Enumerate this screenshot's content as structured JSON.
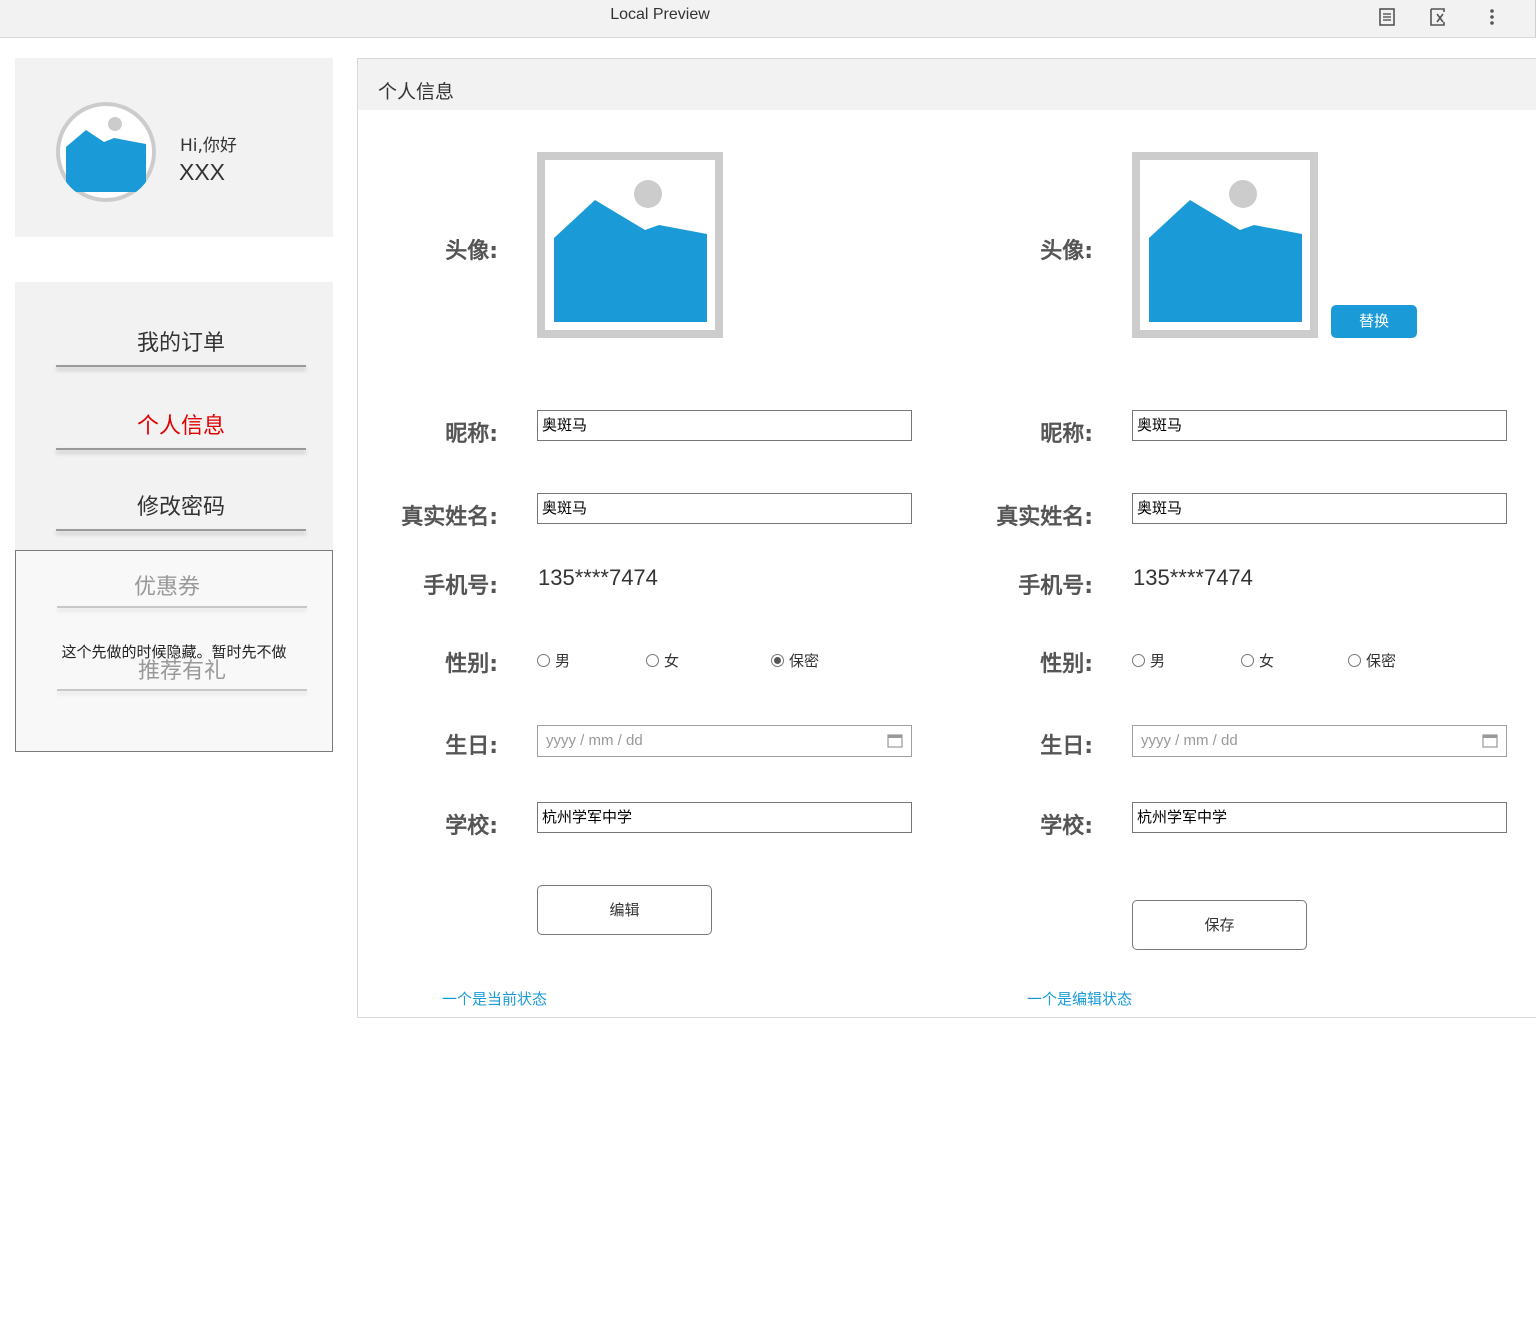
{
  "window": {
    "title": "Local Preview"
  },
  "toolbar": {
    "icons": [
      "document-icon",
      "variable-icon",
      "more-vert-icon"
    ]
  },
  "profile": {
    "greeting": "Hi,你好",
    "username": "XXX"
  },
  "nav": {
    "items": [
      {
        "label": "我的订单",
        "active": false
      },
      {
        "label": "个人信息",
        "active": true
      },
      {
        "label": "修改密码",
        "active": false
      }
    ],
    "hidden_items": [
      "优惠券",
      "推荐有礼"
    ],
    "hidden_note": "这个先做的时候隐藏。暂时先不做"
  },
  "main": {
    "title": "个人信息",
    "labels": {
      "avatar": "头像:",
      "nickname": "昵称:",
      "realname": "真实姓名:",
      "phone": "手机号:",
      "gender": "性别:",
      "birthday": "生日:",
      "school": "学校:"
    },
    "view": {
      "nickname": "奥斑马",
      "realname": "奥斑马",
      "phone": "135****7474",
      "gender_options": [
        "男",
        "女",
        "保密"
      ],
      "gender_selected": "保密",
      "birthday_placeholder": "yyyy / mm / dd",
      "school": "杭州学军中学",
      "action_label": "编辑",
      "state_note": "一个是当前状态"
    },
    "edit": {
      "replace_label": "替换",
      "nickname": "奥斑马",
      "realname": "奥斑马",
      "phone": "135****7474",
      "gender_options": [
        "男",
        "女",
        "保密"
      ],
      "gender_selected": "",
      "birthday_placeholder": "yyyy / mm / dd",
      "school": "杭州学军中学",
      "action_label": "保存",
      "state_note": "一个是编辑状态"
    }
  },
  "colors": {
    "accent": "#1a9bd7",
    "active_nav": "#e00000",
    "panel_bg": "#f2f2f2",
    "placeholder_gray": "#cccccc"
  }
}
